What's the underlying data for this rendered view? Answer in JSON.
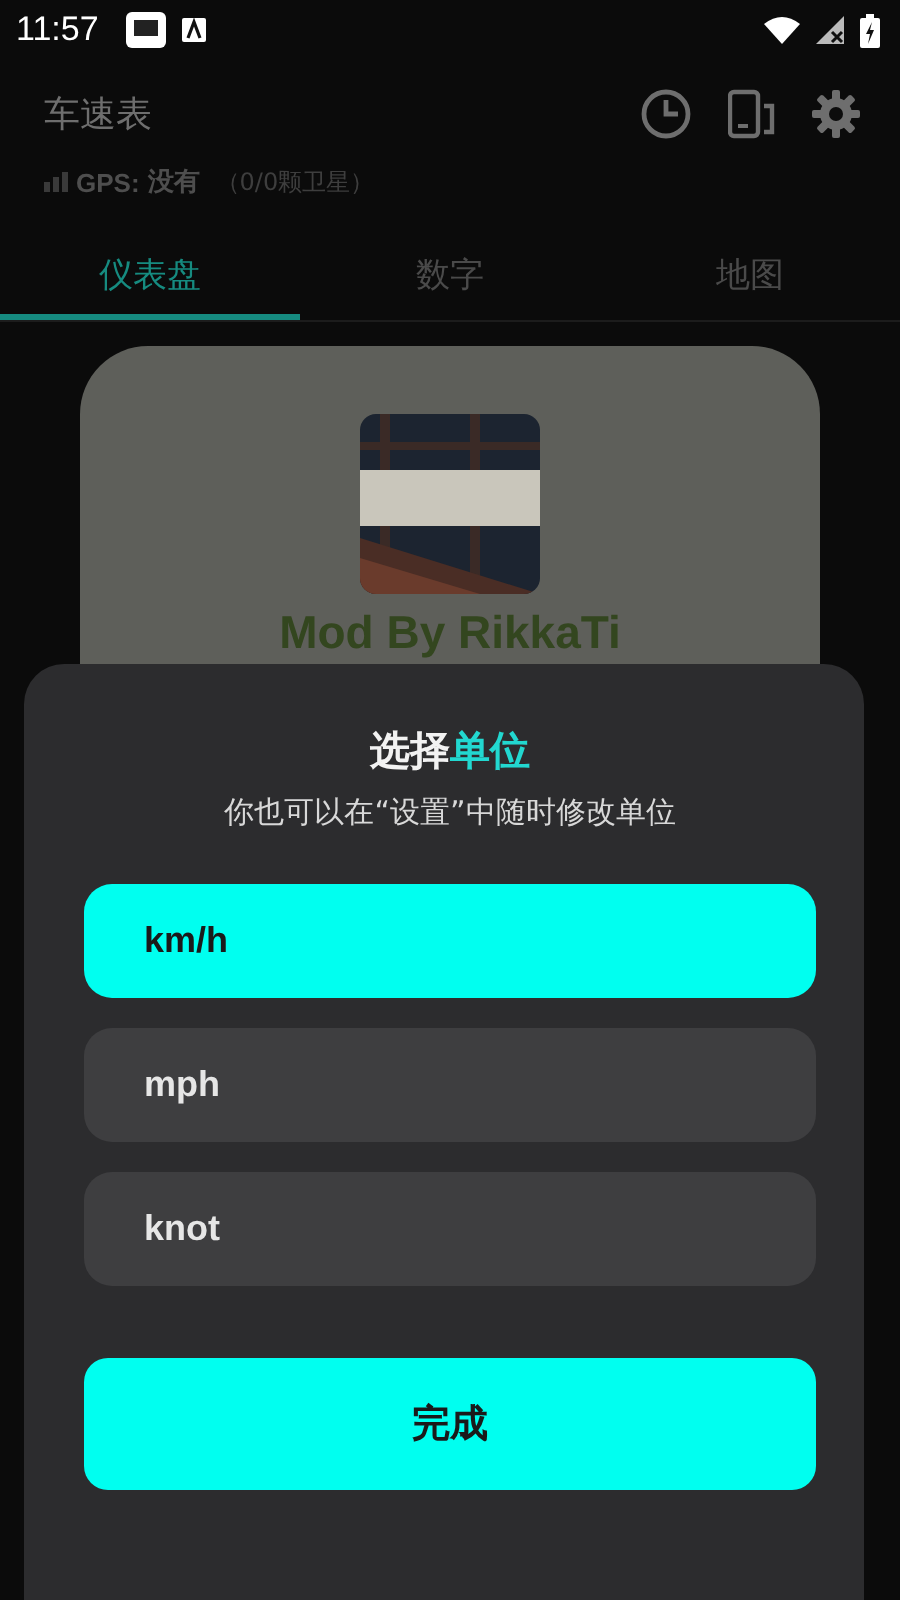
{
  "status_bar": {
    "time": "11:57"
  },
  "app_bar": {
    "title": "车速表",
    "gps_label": "GPS:",
    "gps_value": "没有",
    "gps_detail": "（0/0颗卫星）"
  },
  "tabs": [
    {
      "label": "仪表盘",
      "selected": true
    },
    {
      "label": "数字",
      "selected": false
    },
    {
      "label": "地图",
      "selected": false
    }
  ],
  "card": {
    "caption": "Mod By RikkaTi"
  },
  "dialog": {
    "title": [
      {
        "text": "选择",
        "accent": false
      },
      {
        "text": "单位",
        "accent": true
      }
    ],
    "subtitle": "你也可以在“设置”中随时修改单位",
    "options": [
      {
        "label": "km/h",
        "selected": true
      },
      {
        "label": "mph",
        "selected": false
      },
      {
        "label": "knot",
        "selected": false
      }
    ],
    "confirm": "完成"
  }
}
